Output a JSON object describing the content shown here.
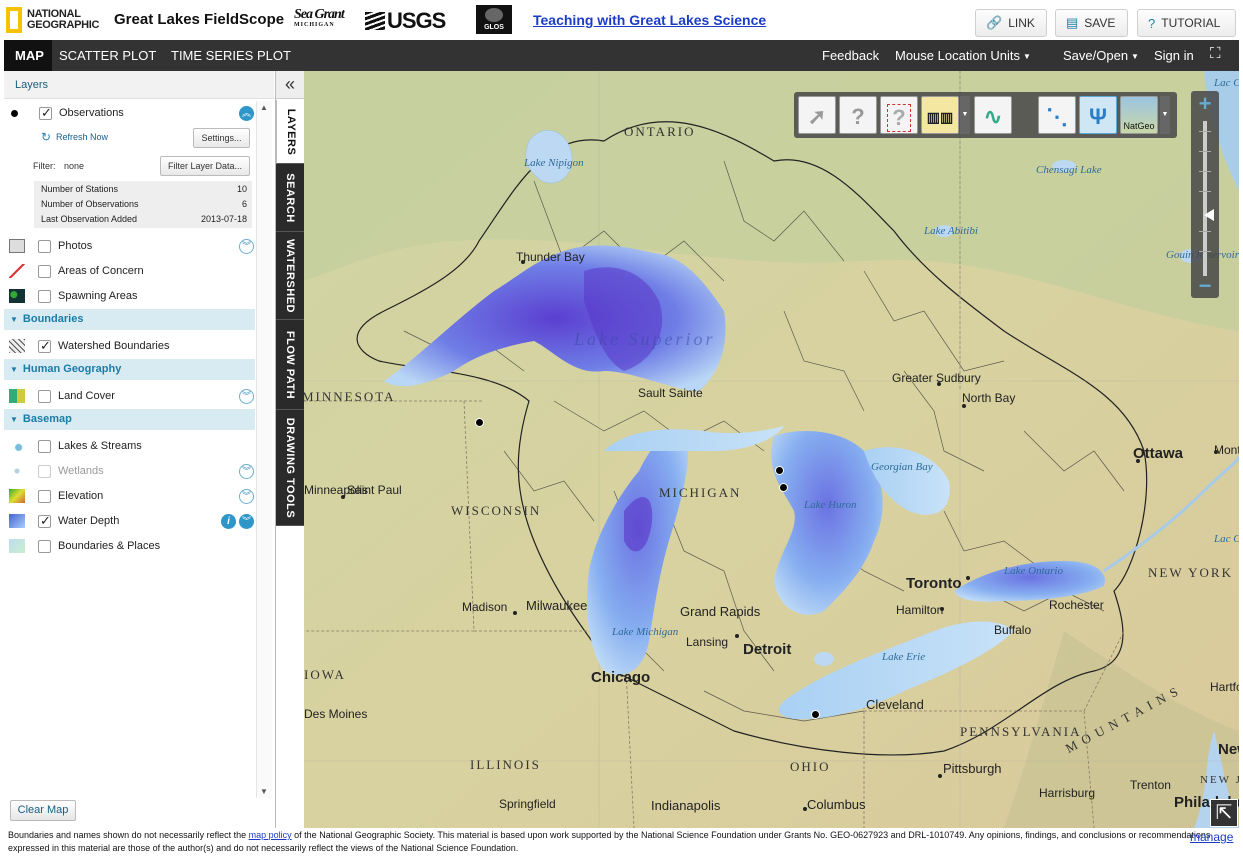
{
  "header": {
    "ng_logo_line1": "NATIONAL",
    "ng_logo_line2": "GEOGRAPHIC",
    "app_title": "Great Lakes FieldScope",
    "seagrant_logo": "Sea Grant",
    "seagrant_sub": "MICHIGAN",
    "usgs_logo": "USGS",
    "glos_logo": "GLOS",
    "teaching_link": "Teaching with Great Lakes Science",
    "link_btn": "LINK",
    "save_btn": "SAVE",
    "tutorial_btn": "TUTORIAL"
  },
  "menubar": {
    "tabs": [
      "MAP",
      "SCATTER PLOT",
      "TIME SERIES PLOT"
    ],
    "feedback": "Feedback",
    "units": "Mouse Location Units",
    "save_open": "Save/Open",
    "sign_in": "Sign in"
  },
  "panel": {
    "title": "Layers",
    "observations": {
      "label": "Observations",
      "refresh": "Refresh Now",
      "settings": "Settings...",
      "filter_label": "Filter:",
      "filter_value": "none",
      "filter_btn": "Filter Layer Data...",
      "stats": [
        {
          "label": "Number of Stations",
          "value": "10"
        },
        {
          "label": "Number of Observations",
          "value": "6"
        },
        {
          "label": "Last Observation Added",
          "value": "2013-07-18"
        }
      ]
    },
    "layers_top": [
      {
        "label": "Photos",
        "checked": false
      },
      {
        "label": "Areas of Concern",
        "checked": false
      },
      {
        "label": "Spawning Areas",
        "checked": false
      }
    ],
    "sections": {
      "boundaries": "Boundaries",
      "human_geography": "Human Geography",
      "basemap": "Basemap"
    },
    "boundaries_layers": [
      {
        "label": "Watershed Boundaries",
        "checked": true
      }
    ],
    "human_layers": [
      {
        "label": "Land Cover",
        "checked": false
      }
    ],
    "basemap_layers": [
      {
        "label": "Lakes & Streams",
        "checked": false
      },
      {
        "label": "Wetlands",
        "checked": false
      },
      {
        "label": "Elevation",
        "checked": false
      },
      {
        "label": "Water Depth",
        "checked": true
      },
      {
        "label": "Boundaries & Places",
        "checked": false
      }
    ],
    "clear_map": "Clear Map"
  },
  "side_tabs": [
    "LAYERS",
    "SEARCH",
    "WATERSHED",
    "FLOW PATH",
    "DRAWING TOOLS"
  ],
  "map": {
    "basemap_button": "NatGeo",
    "regions": [
      "ONTARIO",
      "WISCONSIN",
      "MICHIGAN",
      "IOWA",
      "ILLINOIS",
      "OHIO",
      "PENNSYLVANIA",
      "NEW YORK",
      "MINNESOTA",
      "NEW JERSEY",
      "MOUNTAINS"
    ],
    "water": [
      "Lake Nipigon",
      "Lake Superior",
      "Lake Michigan",
      "Lake Huron",
      "Lake Erie",
      "Lake Ontario",
      "Lake Abitibi",
      "Chensagi Lake",
      "Gouin Reservoir",
      "Georgian Bay",
      "Lac Cassé",
      "Lac Cha"
    ],
    "cities": [
      "Thunder Bay",
      "Sault Sainte",
      "Greater Sudbury",
      "North Bay",
      "Ottawa",
      "Montréal",
      "Minneapolis",
      "Saint Paul",
      "Madison",
      "Milwaukee",
      "Grand Rapids",
      "Lansing",
      "Detroit",
      "Chicago",
      "Toronto",
      "Hamilton",
      "Rochester",
      "Buffalo",
      "Cleveland",
      "Des Moines",
      "Pittsburgh",
      "Harrisburg",
      "Trenton",
      "Springfield",
      "Indianapolis",
      "Columbus",
      "Philadelphia",
      "Hartford",
      "New"
    ]
  },
  "footer": {
    "text_a": "Boundaries and names shown do not necessarily reflect the ",
    "link": "map policy",
    "text_b": " of the National Geographic Society. This material is based upon work supported by the National Science Foundation under Grants No. GEO-0627923 and DRL-1010749. Any opinions, findings, and conclusions or recommendations expressed in this material are those of the author(s) and do not necessarily reflect the views of the National Science Foundation.",
    "manage": "manage"
  }
}
